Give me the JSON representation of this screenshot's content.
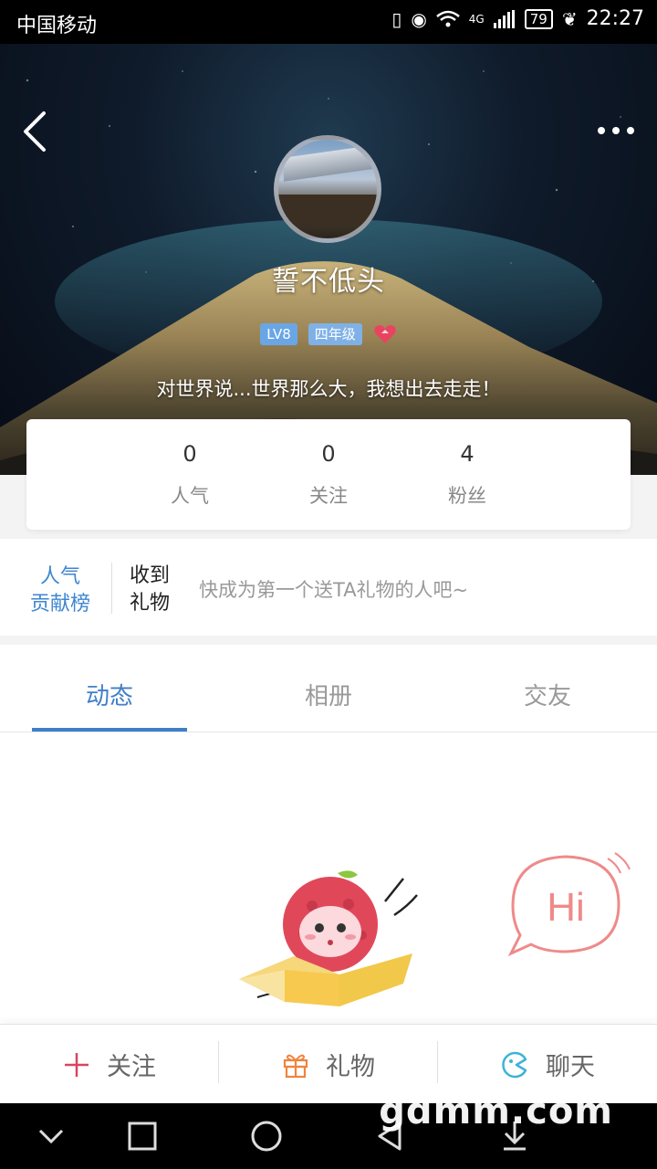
{
  "status_bar": {
    "carrier": "中国移动",
    "network": "4G",
    "battery": "79",
    "time": "22:27"
  },
  "profile": {
    "username": "誓不低头",
    "level_badge": "LV8",
    "grade_badge": "四年级",
    "signature": "对世界说...世界那么大，我想出去走走！"
  },
  "stats": [
    {
      "value": "0",
      "label": "人气"
    },
    {
      "value": "0",
      "label": "关注"
    },
    {
      "value": "4",
      "label": "粉丝"
    }
  ],
  "gifts": {
    "rank_label": "人气贡献榜",
    "received_label": "收到礼物",
    "hint": "快成为第一个送TA礼物的人吧~"
  },
  "tabs": [
    {
      "label": "动态",
      "active": true
    },
    {
      "label": "相册",
      "active": false
    },
    {
      "label": "交友",
      "active": false
    }
  ],
  "hi_bubble_text": "Hi",
  "bottom_actions": {
    "follow": "关注",
    "gift": "礼物",
    "chat": "聊天"
  },
  "watermark": "gdmm.com",
  "colors": {
    "accent": "#3f7fc7",
    "follow_icon": "#d9455f",
    "gift_icon": "#f0843c",
    "chat_icon": "#3cb3d8",
    "hi_bubble": "#ef8a8a"
  }
}
